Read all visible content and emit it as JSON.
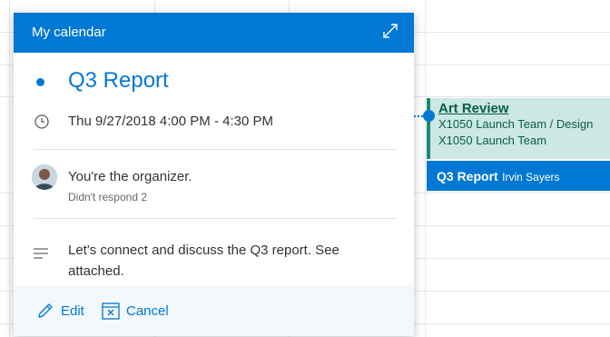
{
  "popup": {
    "header_title": "My calendar",
    "subject": "Q3 Report",
    "datetime": "Thu 9/27/2018 4:00 PM - 4:30 PM",
    "organizer_text": "You're the organizer.",
    "response_text": "Didn't respond 2",
    "description": "Let's connect and discuss the Q3 report. See attached.",
    "actions": {
      "edit_label": "Edit",
      "cancel_label": "Cancel"
    }
  },
  "events": [
    {
      "title": "Art Review",
      "line1": "X1050 Launch Team / Design",
      "line2": "X1050 Launch Team"
    },
    {
      "title": "Q3 Report",
      "organizer": "Irvin Sayers"
    }
  ],
  "colors": {
    "accent": "#0078d4",
    "event_green": "#cce7e4",
    "event_green_border": "#1f8a70",
    "footer_bg": "#f3f8fd"
  },
  "icons": [
    "expand-icon",
    "bullet-dot-icon",
    "clock-icon",
    "avatar-image",
    "description-lines-icon",
    "pencil-icon",
    "calendar-x-icon"
  ]
}
